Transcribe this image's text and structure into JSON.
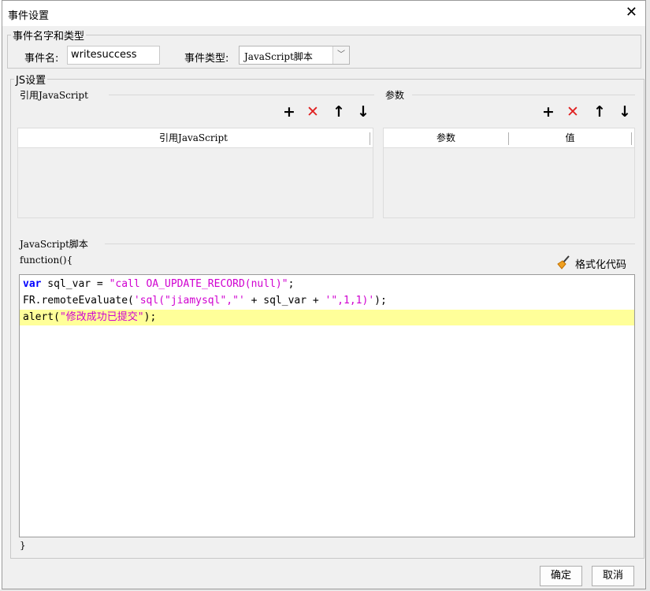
{
  "dialog": {
    "title": "事件设置",
    "close_glyph": "✕"
  },
  "name_group": {
    "legend": "事件名字和类型",
    "name_label": "事件名:",
    "name_value": "writesuccess",
    "type_label": "事件类型:",
    "type_value": "JavaScript脚本"
  },
  "js_group": {
    "legend": "JS设置",
    "ref_section": {
      "label": "引用JavaScript",
      "column_header": "引用JavaScript",
      "toolbar": {
        "add": "+",
        "remove": "✕",
        "up": "↑",
        "down": "↓"
      }
    },
    "param_section": {
      "label": "参数",
      "columns": [
        "参数",
        "值"
      ],
      "toolbar": {
        "add": "+",
        "remove": "✕",
        "up": "↑",
        "down": "↓"
      }
    },
    "script_section": {
      "label": "JavaScript脚本",
      "func_open": "function(){",
      "func_close": "}",
      "format_label": "格式化代码",
      "code": {
        "line1_kw": "var",
        "line1_mid": " sql_var = ",
        "line1_str": "\"call OA_UPDATE_RECORD(null)\"",
        "line1_end": ";",
        "line2_pre": "FR.remoteEvaluate(",
        "line2_str1": "'sql(\"jiamysql\",\"'",
        "line2_mid": " + sql_var + ",
        "line2_str2": "'\",1,1)'",
        "line2_end": ");",
        "line3_pre": "alert(",
        "line3_str": "\"修改成功已提交\"",
        "line3_end": ");"
      }
    }
  },
  "buttons": {
    "ok": "确定",
    "cancel": "取消"
  }
}
